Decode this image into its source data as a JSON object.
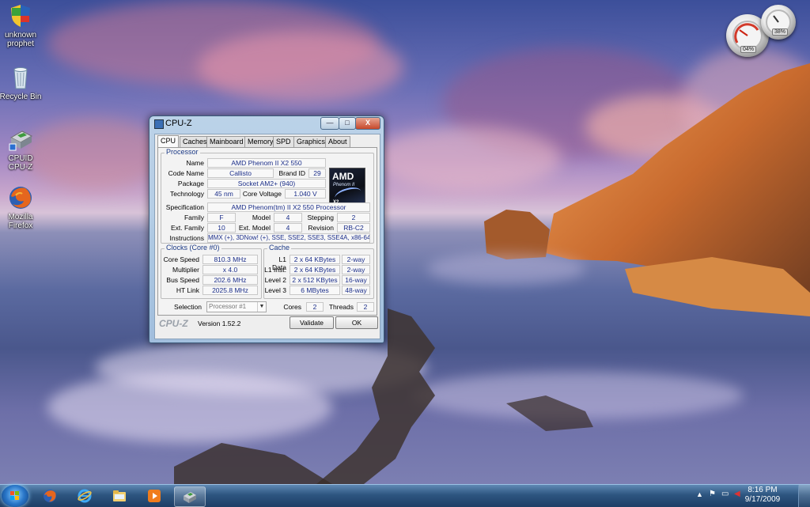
{
  "desktop": {
    "icons": [
      {
        "label": "unknown prophet"
      },
      {
        "label": "Recycle Bin"
      },
      {
        "label": "CPUID CPU-Z"
      },
      {
        "label": "Mozilla Firefox"
      }
    ],
    "gadgets": {
      "meter_1_value": "04%",
      "meter_2_value": "38%"
    }
  },
  "window": {
    "title": "CPU-Z",
    "controls": {
      "minimize": "—",
      "maximize": "□",
      "close": "X"
    },
    "tabs": [
      "CPU",
      "Caches",
      "Mainboard",
      "Memory",
      "SPD",
      "Graphics",
      "About"
    ],
    "active_tab": "CPU",
    "processor": {
      "group_title": "Processor",
      "name_label": "Name",
      "name": "AMD Phenom II X2 550",
      "codename_label": "Code Name",
      "codename": "Callisto",
      "brandid_label": "Brand ID",
      "brandid": "29",
      "package_label": "Package",
      "package": "Socket AM2+ (940)",
      "technology_label": "Technology",
      "technology": "45 nm",
      "voltage_label": "Core Voltage",
      "voltage": "1.040 V",
      "spec_label": "Specification",
      "spec": "AMD Phenom(tm) II X2 550 Processor",
      "family_label": "Family",
      "family": "F",
      "model_label": "Model",
      "model": "4",
      "stepping_label": "Stepping",
      "stepping": "2",
      "extfamily_label": "Ext. Family",
      "extfamily": "10",
      "extmodel_label": "Ext. Model",
      "extmodel": "4",
      "revision_label": "Revision",
      "revision": "RB-C2",
      "instructions_label": "Instructions",
      "instructions": "MMX (+), 3DNow! (+), SSE, SSE2, SSE3, SSE4A, x86-64",
      "logo_brand": "AMD",
      "logo_line": "Phenom II",
      "logo_model": "X2"
    },
    "clocks": {
      "group_title": "Clocks (Core #0)",
      "corespeed_label": "Core Speed",
      "corespeed": "810.3 MHz",
      "multiplier_label": "Multiplier",
      "multiplier": "x 4.0",
      "busspeed_label": "Bus Speed",
      "busspeed": "202.6 MHz",
      "htlink_label": "HT Link",
      "htlink": "2025.8 MHz"
    },
    "cache": {
      "group_title": "Cache",
      "l1d_label": "L1 Data",
      "l1d": "2 x 64 KBytes",
      "l1d_way": "2-way",
      "l1i_label": "L1 Inst.",
      "l1i": "2 x 64 KBytes",
      "l1i_way": "2-way",
      "l2_label": "Level 2",
      "l2": "2 x 512 KBytes",
      "l2_way": "16-way",
      "l3_label": "Level 3",
      "l3": "6 MBytes",
      "l3_way": "48-way"
    },
    "selection": {
      "label": "Selection",
      "value": "Processor #1",
      "cores_label": "Cores",
      "cores": "2",
      "threads_label": "Threads",
      "threads": "2"
    },
    "footer": {
      "brand": "CPU-Z",
      "version": "Version 1.52.2",
      "validate": "Validate",
      "ok": "OK"
    }
  },
  "taskbar": {
    "items": [
      "start",
      "firefox",
      "internet-explorer",
      "explorer",
      "media-player",
      "cpu-z"
    ],
    "clock_time": "8:16 PM",
    "clock_date": "9/17/2009"
  }
}
